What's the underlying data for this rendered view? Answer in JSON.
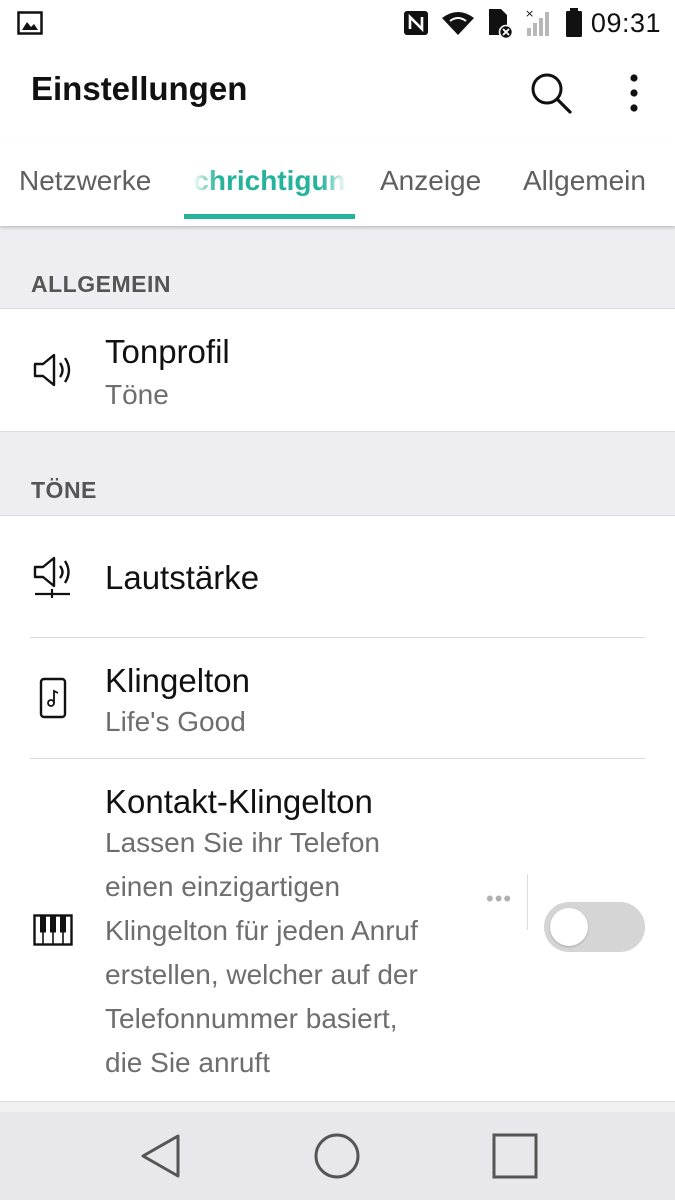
{
  "status_bar": {
    "time": "09:31",
    "icons": [
      "gallery-notification-icon",
      "nfc-icon",
      "wifi-icon",
      "sim-error-icon",
      "signal-icon",
      "battery-icon"
    ]
  },
  "app_bar": {
    "title": "Einstellungen",
    "actions": [
      "search-icon",
      "more-vert-icon"
    ]
  },
  "tabs": {
    "items": [
      "Netzwerke",
      "chrichtigun",
      "Anzeige",
      "Allgemein"
    ],
    "active_index": 1,
    "accent_color": "#26b39c"
  },
  "sections": [
    {
      "header": "ALLGEMEIN",
      "items": [
        {
          "icon": "speaker-icon",
          "title": "Tonprofil",
          "subtitle": "Töne"
        }
      ]
    },
    {
      "header": "TÖNE",
      "items": [
        {
          "icon": "volume-icon",
          "title": "Lautstärke"
        },
        {
          "icon": "ringtone-file-icon",
          "title": "Klingelton",
          "subtitle": "Life's Good"
        },
        {
          "icon": "piano-icon",
          "title": "Kontakt-Klingelton",
          "description_lines": [
            "Lassen Sie ihr Telefon",
            "einen einzigartigen",
            "Klingelton für jeden Anruf",
            "erstellen, welcher auf der",
            "Telefonnummer basiert,",
            "die Sie anruft"
          ],
          "toggle_on": false
        }
      ]
    }
  ],
  "nav_bar": [
    "back-icon",
    "home-icon",
    "recents-icon"
  ]
}
